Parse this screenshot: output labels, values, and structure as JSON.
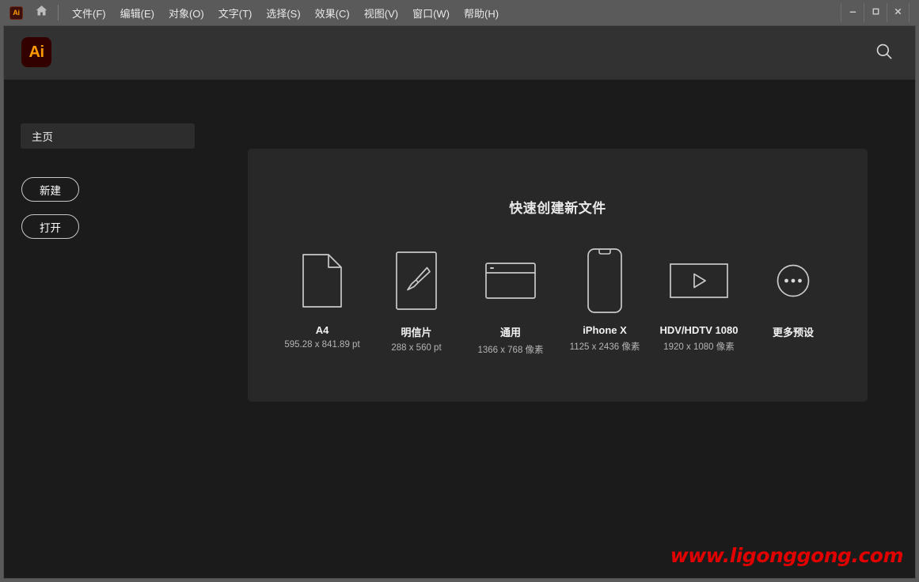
{
  "window": {
    "app_badge": "Ai",
    "home_icon": "home-icon",
    "controls": {
      "minimize": "minimize-icon",
      "maximize": "maximize-icon",
      "close": "close-icon"
    }
  },
  "menubar": {
    "items": [
      {
        "label": "文件(F)"
      },
      {
        "label": "编辑(E)"
      },
      {
        "label": "对象(O)"
      },
      {
        "label": "文字(T)"
      },
      {
        "label": "选择(S)"
      },
      {
        "label": "效果(C)"
      },
      {
        "label": "视图(V)"
      },
      {
        "label": "窗口(W)"
      },
      {
        "label": "帮助(H)"
      }
    ]
  },
  "header": {
    "logo": "Ai",
    "search_icon": "search-icon"
  },
  "sidebar": {
    "nav_tab": "主页",
    "new_button": "新建",
    "open_button": "打开"
  },
  "main": {
    "title": "快速创建新文件",
    "presets": [
      {
        "label": "A4",
        "dims": "595.28 x 841.89 pt",
        "icon": "document-page-icon"
      },
      {
        "label": "明信片",
        "dims": "288 x 560 pt",
        "icon": "paintbrush-canvas-icon"
      },
      {
        "label": "通用",
        "dims": "1366 x 768 像素",
        "icon": "browser-window-icon"
      },
      {
        "label": "iPhone X",
        "dims": "1125 x 2436 像素",
        "icon": "phone-icon"
      },
      {
        "label": "HDV/HDTV 1080",
        "dims": "1920 x 1080 像素",
        "icon": "video-play-icon"
      },
      {
        "label": "更多预设",
        "dims": "",
        "icon": "more-ellipsis-circle-icon"
      }
    ]
  },
  "watermark": {
    "text": "www.ligonggong.com"
  },
  "colors": {
    "titlebar": "#5a5a5a",
    "app_header": "#323232",
    "body_bg": "#1b1b1b",
    "panel_bg": "#282828",
    "accent_orange": "#ff9a00",
    "badge_maroon": "#330000",
    "watermark_red": "#e00000"
  }
}
